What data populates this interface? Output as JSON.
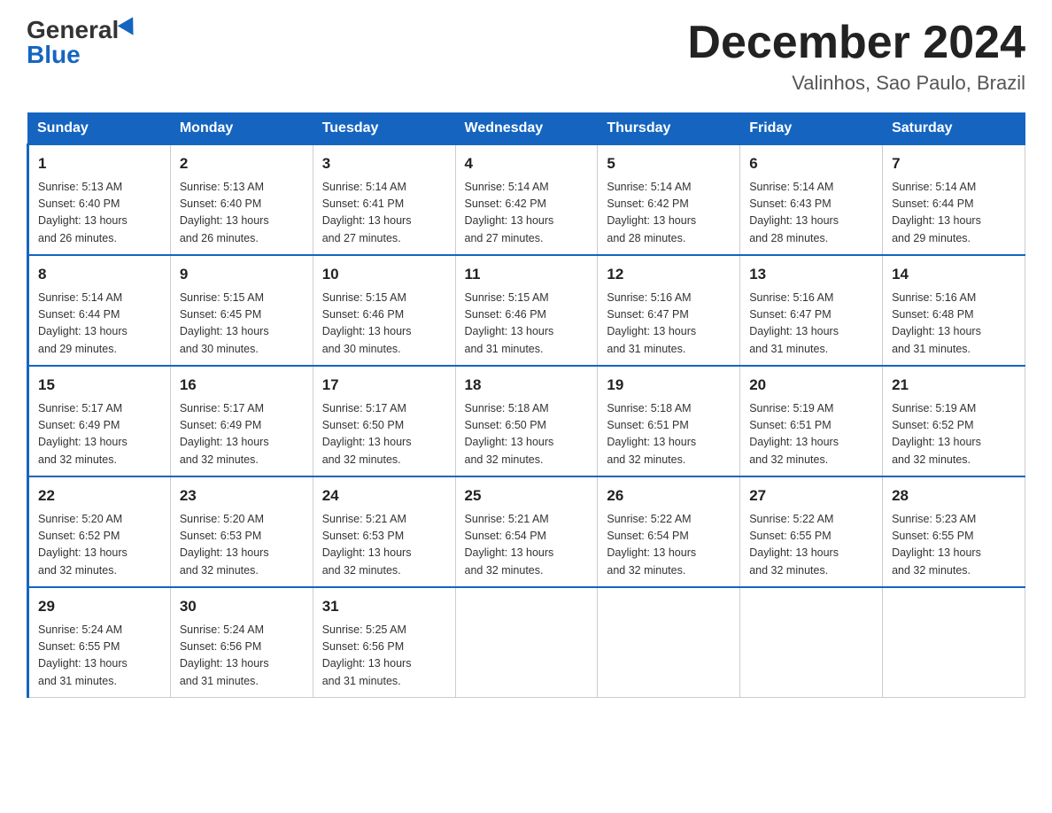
{
  "header": {
    "logo_general": "General",
    "logo_blue": "Blue",
    "month_title": "December 2024",
    "location": "Valinhos, Sao Paulo, Brazil"
  },
  "days_of_week": [
    "Sunday",
    "Monday",
    "Tuesday",
    "Wednesday",
    "Thursday",
    "Friday",
    "Saturday"
  ],
  "weeks": [
    [
      {
        "day": "1",
        "sunrise": "5:13 AM",
        "sunset": "6:40 PM",
        "daylight": "13 hours and 26 minutes."
      },
      {
        "day": "2",
        "sunrise": "5:13 AM",
        "sunset": "6:40 PM",
        "daylight": "13 hours and 26 minutes."
      },
      {
        "day": "3",
        "sunrise": "5:14 AM",
        "sunset": "6:41 PM",
        "daylight": "13 hours and 27 minutes."
      },
      {
        "day": "4",
        "sunrise": "5:14 AM",
        "sunset": "6:42 PM",
        "daylight": "13 hours and 27 minutes."
      },
      {
        "day": "5",
        "sunrise": "5:14 AM",
        "sunset": "6:42 PM",
        "daylight": "13 hours and 28 minutes."
      },
      {
        "day": "6",
        "sunrise": "5:14 AM",
        "sunset": "6:43 PM",
        "daylight": "13 hours and 28 minutes."
      },
      {
        "day": "7",
        "sunrise": "5:14 AM",
        "sunset": "6:44 PM",
        "daylight": "13 hours and 29 minutes."
      }
    ],
    [
      {
        "day": "8",
        "sunrise": "5:14 AM",
        "sunset": "6:44 PM",
        "daylight": "13 hours and 29 minutes."
      },
      {
        "day": "9",
        "sunrise": "5:15 AM",
        "sunset": "6:45 PM",
        "daylight": "13 hours and 30 minutes."
      },
      {
        "day": "10",
        "sunrise": "5:15 AM",
        "sunset": "6:46 PM",
        "daylight": "13 hours and 30 minutes."
      },
      {
        "day": "11",
        "sunrise": "5:15 AM",
        "sunset": "6:46 PM",
        "daylight": "13 hours and 31 minutes."
      },
      {
        "day": "12",
        "sunrise": "5:16 AM",
        "sunset": "6:47 PM",
        "daylight": "13 hours and 31 minutes."
      },
      {
        "day": "13",
        "sunrise": "5:16 AM",
        "sunset": "6:47 PM",
        "daylight": "13 hours and 31 minutes."
      },
      {
        "day": "14",
        "sunrise": "5:16 AM",
        "sunset": "6:48 PM",
        "daylight": "13 hours and 31 minutes."
      }
    ],
    [
      {
        "day": "15",
        "sunrise": "5:17 AM",
        "sunset": "6:49 PM",
        "daylight": "13 hours and 32 minutes."
      },
      {
        "day": "16",
        "sunrise": "5:17 AM",
        "sunset": "6:49 PM",
        "daylight": "13 hours and 32 minutes."
      },
      {
        "day": "17",
        "sunrise": "5:17 AM",
        "sunset": "6:50 PM",
        "daylight": "13 hours and 32 minutes."
      },
      {
        "day": "18",
        "sunrise": "5:18 AM",
        "sunset": "6:50 PM",
        "daylight": "13 hours and 32 minutes."
      },
      {
        "day": "19",
        "sunrise": "5:18 AM",
        "sunset": "6:51 PM",
        "daylight": "13 hours and 32 minutes."
      },
      {
        "day": "20",
        "sunrise": "5:19 AM",
        "sunset": "6:51 PM",
        "daylight": "13 hours and 32 minutes."
      },
      {
        "day": "21",
        "sunrise": "5:19 AM",
        "sunset": "6:52 PM",
        "daylight": "13 hours and 32 minutes."
      }
    ],
    [
      {
        "day": "22",
        "sunrise": "5:20 AM",
        "sunset": "6:52 PM",
        "daylight": "13 hours and 32 minutes."
      },
      {
        "day": "23",
        "sunrise": "5:20 AM",
        "sunset": "6:53 PM",
        "daylight": "13 hours and 32 minutes."
      },
      {
        "day": "24",
        "sunrise": "5:21 AM",
        "sunset": "6:53 PM",
        "daylight": "13 hours and 32 minutes."
      },
      {
        "day": "25",
        "sunrise": "5:21 AM",
        "sunset": "6:54 PM",
        "daylight": "13 hours and 32 minutes."
      },
      {
        "day": "26",
        "sunrise": "5:22 AM",
        "sunset": "6:54 PM",
        "daylight": "13 hours and 32 minutes."
      },
      {
        "day": "27",
        "sunrise": "5:22 AM",
        "sunset": "6:55 PM",
        "daylight": "13 hours and 32 minutes."
      },
      {
        "day": "28",
        "sunrise": "5:23 AM",
        "sunset": "6:55 PM",
        "daylight": "13 hours and 32 minutes."
      }
    ],
    [
      {
        "day": "29",
        "sunrise": "5:24 AM",
        "sunset": "6:55 PM",
        "daylight": "13 hours and 31 minutes."
      },
      {
        "day": "30",
        "sunrise": "5:24 AM",
        "sunset": "6:56 PM",
        "daylight": "13 hours and 31 minutes."
      },
      {
        "day": "31",
        "sunrise": "5:25 AM",
        "sunset": "6:56 PM",
        "daylight": "13 hours and 31 minutes."
      },
      null,
      null,
      null,
      null
    ]
  ]
}
